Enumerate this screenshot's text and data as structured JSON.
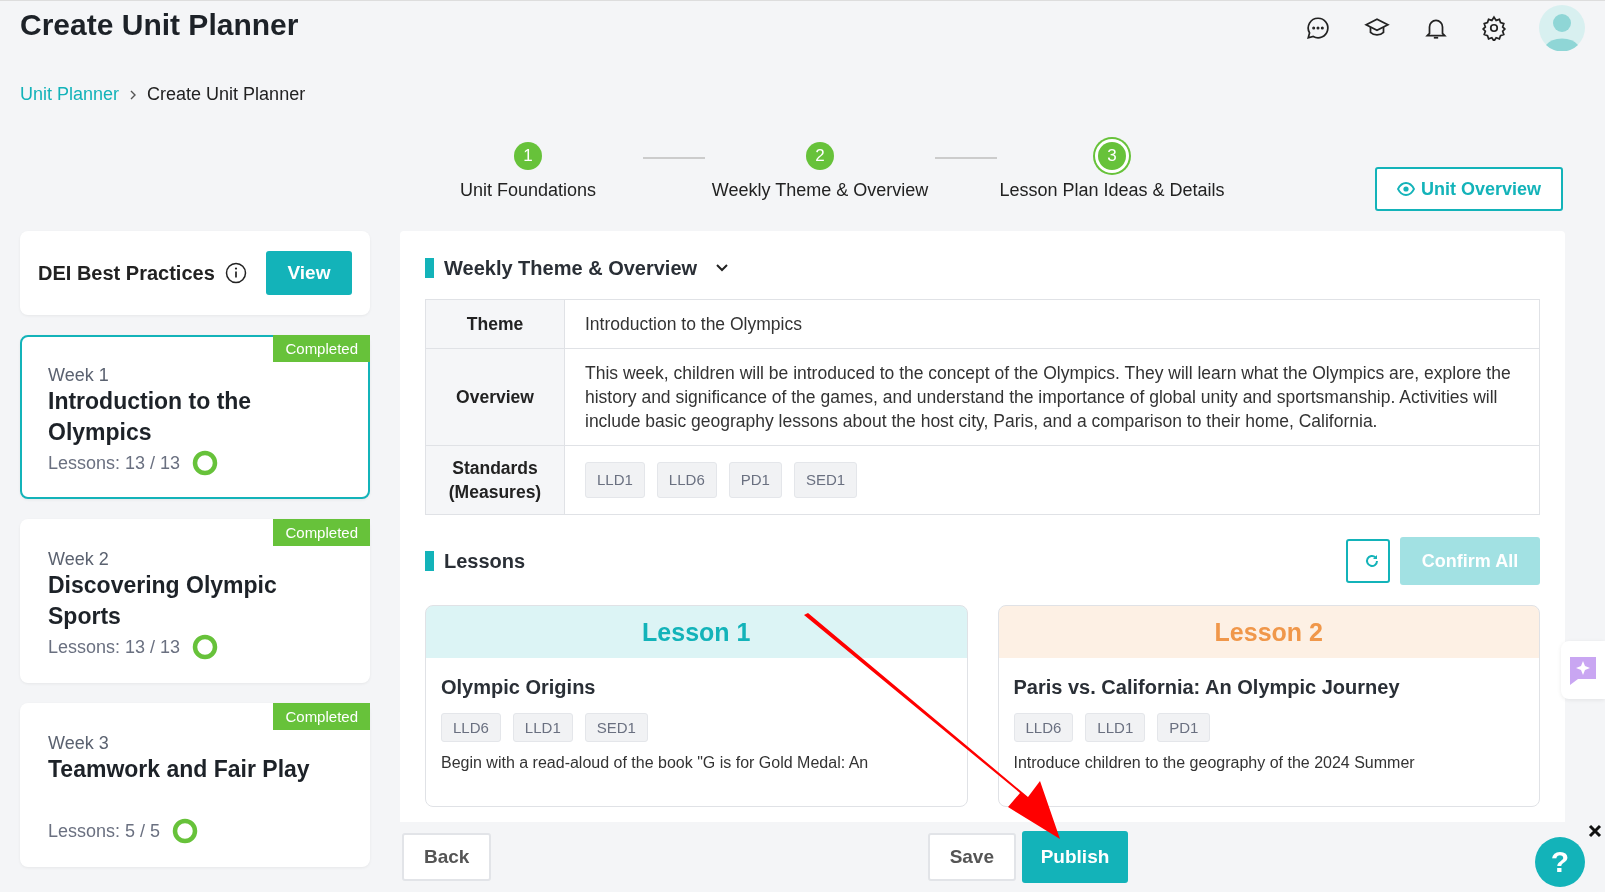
{
  "header": {
    "title": "Create Unit Planner"
  },
  "breadcrumb": [
    {
      "label": "Unit Planner",
      "kind": "link"
    },
    {
      "label": "Create Unit Planner",
      "kind": "current"
    }
  ],
  "steps": [
    {
      "number": "1",
      "label": "Unit Foundations",
      "selected": false
    },
    {
      "number": "2",
      "label": "Weekly Theme & Overview",
      "selected": false
    },
    {
      "number": "3",
      "label": "Lesson Plan Ideas & Details",
      "selected": true
    }
  ],
  "unit_overview_button": "Unit Overview",
  "dei": {
    "label": "DEI Best Practices",
    "button": "View"
  },
  "weeks": [
    {
      "week": "Week 1",
      "title": "Introduction to the Olympics",
      "badge": "Completed",
      "lessons": "Lessons: 13 / 13",
      "selected": true
    },
    {
      "week": "Week 2",
      "title": "Discovering Olympic Sports",
      "badge": "Completed",
      "lessons": "Lessons: 13 / 13",
      "selected": false
    },
    {
      "week": "Week 3",
      "title": "Teamwork and Fair Play",
      "badge": "Completed",
      "lessons": "Lessons: 5 / 5",
      "selected": false
    }
  ],
  "weekly_section": {
    "title": "Weekly Theme & Overview",
    "expanded": true,
    "rows": [
      {
        "label": "Theme",
        "kind": "text",
        "value": "Introduction to the Olympics"
      },
      {
        "label": "Overview",
        "kind": "text",
        "value": "This week, children will be introduced to the concept of the Olympics. They will learn what the Olympics are, explore the history and significance of the games, and understand the importance of global unity and sportsmanship. Activities will include basic geography lessons about the host city, Paris, and a comparison to their home, California."
      },
      {
        "label": "Standards (Measures)",
        "kind": "tags",
        "tags": [
          "LLD1",
          "LLD6",
          "PD1",
          "SED1"
        ]
      }
    ]
  },
  "lessons_section": {
    "title": "Lessons",
    "confirm_all": {
      "label": "Confirm All",
      "disabled": true
    },
    "lessons": [
      {
        "header": "Lesson 1",
        "color": "#13b3b9",
        "title": "Olympic Origins",
        "tags": [
          "LLD6",
          "LLD1",
          "SED1"
        ],
        "description": "Begin with a read-aloud of the book \"G is for Gold Medal: An"
      },
      {
        "header": "Lesson 2",
        "color": "#f0974a",
        "title": "Paris vs. California: An Olympic Journey",
        "tags": [
          "LLD6",
          "LLD1",
          "PD1"
        ],
        "description": "Introduce children to the geography of the 2024 Summer"
      }
    ]
  },
  "footer": {
    "back": "Back",
    "save": "Save",
    "publish": "Publish"
  },
  "help_button": "?"
}
